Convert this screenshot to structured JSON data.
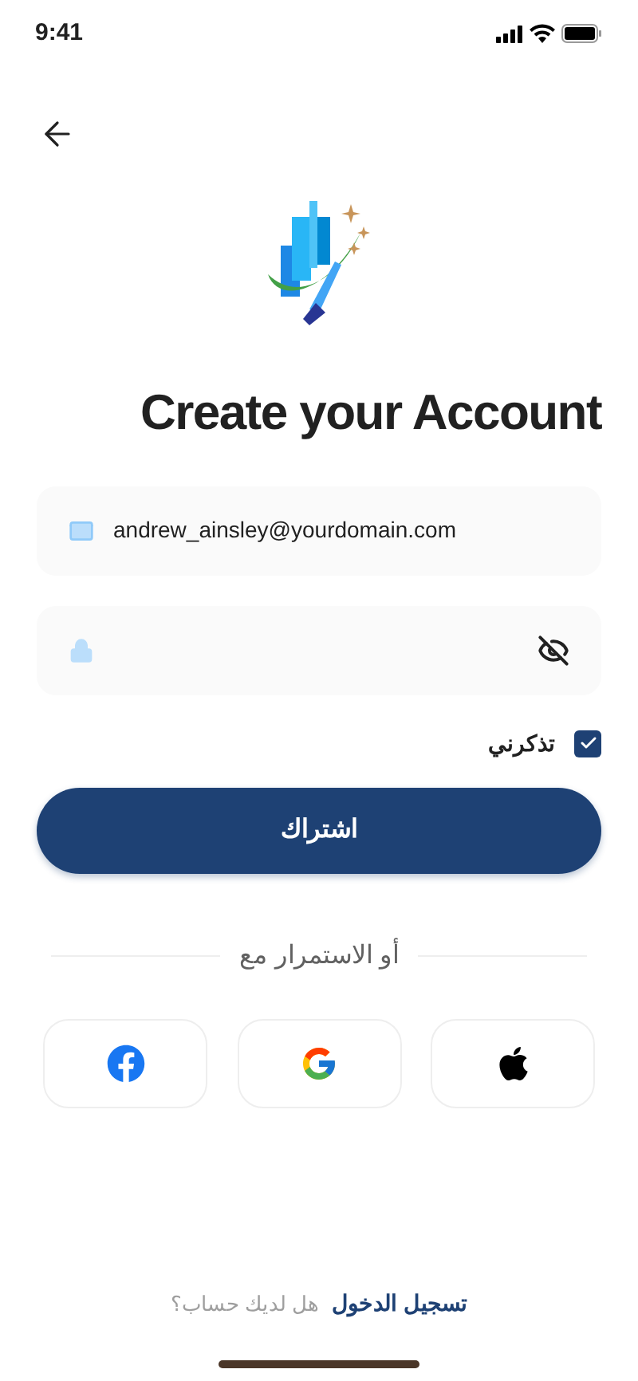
{
  "status_bar": {
    "time": "9:41"
  },
  "title": "Create your Account",
  "email_field": {
    "value": "andrew_ainsley@yourdomain.com"
  },
  "password_field": {
    "masked": true
  },
  "remember": {
    "label": "تذكرني",
    "checked": true
  },
  "submit_button": {
    "label": "اشتراك"
  },
  "divider_text": "أو الاستمرار مع",
  "social_buttons": [
    {
      "kind": "facebook"
    },
    {
      "kind": "google"
    },
    {
      "kind": "apple"
    }
  ],
  "footer": {
    "link": "تسجيل الدخول",
    "text": "هل لديك حساب؟"
  }
}
